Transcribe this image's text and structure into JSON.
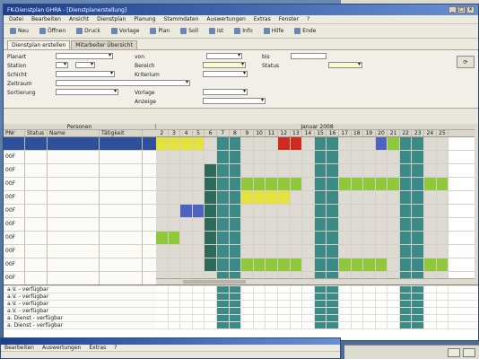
{
  "window": {
    "title": "FK-Dienstplan GHRA - [Dienstplanerstellung]"
  },
  "menu": [
    "Datei",
    "Bearbeiten",
    "Ansicht",
    "Dienstplan",
    "Planung",
    "Stammdaten",
    "Auswertungen",
    "Extras",
    "Fenster",
    "?"
  ],
  "toolbar": [
    "Neu",
    "Öffnen",
    "Druck",
    "Vorlage",
    "Plan",
    "Soll",
    "Ist",
    "Info",
    "Hilfe",
    "Ende"
  ],
  "tabs": [
    {
      "label": "Dienstplan erstellen",
      "active": true
    },
    {
      "label": "Mitarbeiter Übersicht",
      "active": false
    }
  ],
  "form": {
    "planart_label": "Planart",
    "planart_value": "",
    "von_label": "von",
    "von_value": "",
    "bis_label": "bis",
    "bis_value": "",
    "station_label": "Station",
    "station_value": "",
    "bereich_label": "Bereich",
    "bereich_value": "",
    "status_label": "Status",
    "status_value": "",
    "schicht_label": "Schicht",
    "schicht_value": "",
    "kriterium_label": "Kriterium",
    "kriterium_value": "",
    "zeitraum_label": "Zeitraum",
    "zeitraum_value": "",
    "vorlage_label": "Vorlage",
    "vorlage_value": "",
    "sortierung_label": "Sortierung",
    "sortierung_value": "",
    "anzeige_label": "Anzeige",
    "anzeige_value": ""
  },
  "grid": {
    "section_left": "Personen",
    "section_right": "Januar 2008",
    "columns": [
      "PNr",
      "Status",
      "Name",
      "Tätigkeit"
    ],
    "days": [
      "2",
      "3",
      "4",
      "5",
      "6",
      "7",
      "8",
      "9",
      "10",
      "11",
      "12",
      "13",
      "14",
      "15",
      "16",
      "17",
      "18",
      "19",
      "20",
      "21",
      "22",
      "23",
      "24",
      "25"
    ],
    "rows": [
      {
        "pnr": "",
        "status": "",
        "name": "",
        "role": "",
        "selected": true,
        "cells": [
          "y",
          "y",
          "y",
          "y",
          "",
          "t",
          "t",
          "",
          "",
          "",
          "r",
          "r",
          "",
          "t",
          "t",
          "",
          "",
          "",
          "b",
          "g",
          "t",
          "t",
          "",
          ""
        ]
      },
      {
        "pnr": "00F",
        "status": "",
        "name": "",
        "role": "",
        "cells": [
          "",
          "",
          "",
          "",
          "",
          "t",
          "t",
          "",
          "",
          "",
          "",
          "",
          "",
          "t",
          "t",
          "",
          "",
          "",
          "",
          "",
          "t",
          "t",
          "",
          ""
        ]
      },
      {
        "pnr": "00F",
        "status": "",
        "name": "",
        "role": "",
        "cells": [
          "",
          "",
          "",
          "",
          "d",
          "t",
          "t",
          "",
          "",
          "",
          "",
          "",
          "",
          "t",
          "t",
          "",
          "",
          "",
          "",
          "",
          "t",
          "t",
          "",
          ""
        ]
      },
      {
        "pnr": "00F",
        "status": "",
        "name": "",
        "role": "",
        "cells": [
          "",
          "",
          "",
          "",
          "d",
          "t",
          "t",
          "g",
          "g",
          "g",
          "g",
          "g",
          "",
          "t",
          "t",
          "g",
          "g",
          "g",
          "g",
          "g",
          "t",
          "t",
          "g",
          "g"
        ]
      },
      {
        "pnr": "00F",
        "status": "",
        "name": "",
        "role": "",
        "cells": [
          "",
          "",
          "",
          "",
          "d",
          "t",
          "t",
          "y",
          "y",
          "y",
          "y",
          "",
          "",
          "t",
          "t",
          "",
          "",
          "",
          "",
          "",
          "t",
          "t",
          "",
          ""
        ]
      },
      {
        "pnr": "00F",
        "status": "",
        "name": "",
        "role": "",
        "cells": [
          "",
          "",
          "b",
          "b",
          "d",
          "t",
          "t",
          "",
          "",
          "",
          "",
          "",
          "",
          "t",
          "t",
          "",
          "",
          "",
          "",
          "",
          "t",
          "t",
          "",
          ""
        ]
      },
      {
        "pnr": "00F",
        "status": "",
        "name": "",
        "role": "",
        "cells": [
          "",
          "",
          "",
          "",
          "d",
          "t",
          "t",
          "",
          "",
          "",
          "",
          "",
          "",
          "t",
          "t",
          "",
          "",
          "",
          "",
          "",
          "t",
          "t",
          "",
          ""
        ]
      },
      {
        "pnr": "00F",
        "status": "",
        "name": "",
        "role": "",
        "cells": [
          "g",
          "g",
          "",
          "",
          "d",
          "t",
          "t",
          "",
          "",
          "",
          "",
          "",
          "",
          "t",
          "t",
          "",
          "",
          "",
          "",
          "",
          "t",
          "t",
          "",
          ""
        ]
      },
      {
        "pnr": "00F",
        "status": "",
        "name": "",
        "role": "",
        "cells": [
          "",
          "",
          "",
          "",
          "d",
          "t",
          "t",
          "",
          "",
          "",
          "",
          "",
          "",
          "t",
          "t",
          "",
          "",
          "",
          "",
          "",
          "t",
          "t",
          "",
          ""
        ]
      },
      {
        "pnr": "00F",
        "status": "",
        "name": "",
        "role": "",
        "cells": [
          "",
          "",
          "",
          "",
          "d",
          "t",
          "t",
          "g",
          "g",
          "g",
          "g",
          "g",
          "",
          "t",
          "t",
          "g",
          "g",
          "g",
          "g",
          "",
          "t",
          "t",
          "g",
          "g"
        ]
      },
      {
        "pnr": "00F",
        "status": "",
        "name": "",
        "role": "",
        "cells": [
          "",
          "",
          "",
          "",
          "",
          "t",
          "t",
          "",
          "",
          "",
          "",
          "",
          "",
          "t",
          "t",
          "",
          "",
          "",
          "",
          "",
          "t",
          "t",
          "",
          ""
        ]
      },
      {
        "pnr": "00F",
        "status": "",
        "name": "",
        "role": "",
        "cells": [
          "",
          "",
          "",
          "",
          "",
          "t",
          "t",
          "",
          "",
          "",
          "",
          "",
          "",
          "t",
          "t",
          "",
          "",
          "",
          "",
          "",
          "t",
          "t",
          "",
          ""
        ]
      }
    ],
    "colors": {
      "y": "#e6e23c",
      "g": "#8fc83a",
      "t": "#3c8a88",
      "d": "#2e6a5a",
      "b": "#4d63c4",
      "r": "#d02a1e",
      "": "#dcdad2"
    }
  },
  "bottom_rows": [
    "a.V. - verfügbar",
    "a.V. - verfügbar",
    "a.V. - verfügbar",
    "a.V. - verfügbar",
    "a. Dienst - verfügbar",
    "a. Dienst - verfügbar"
  ],
  "status": {
    "date": "",
    "time": ""
  }
}
